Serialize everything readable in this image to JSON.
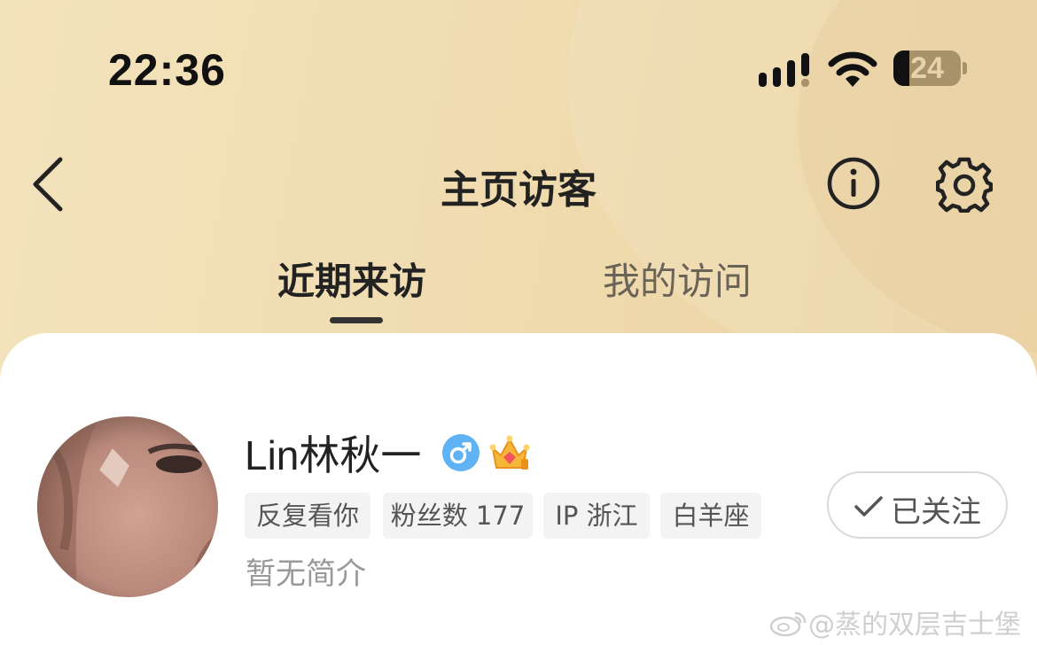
{
  "status_bar": {
    "time": "22:36",
    "battery_percent": "24",
    "battery_level": 0.24
  },
  "nav": {
    "title": "主页访客"
  },
  "tabs": [
    {
      "label": "近期来访",
      "active": true
    },
    {
      "label": "我的访问",
      "active": false
    }
  ],
  "visitor": {
    "name": "Lin林秋一",
    "gender_icon": "male-icon",
    "badge_icon": "crown-icon",
    "tags": [
      "反复看你",
      "粉丝数 177",
      "IP 浙江",
      "白羊座"
    ],
    "bio": "暂无简介",
    "follow_label": "已关注"
  },
  "watermark": "@蒸的双层吉士堡",
  "colors": {
    "header_gradient_start": "#f3e3bd",
    "header_gradient_end": "#ecd3a2",
    "gender_blue": "#5fb2f3",
    "tag_bg": "#f3f3f3"
  }
}
